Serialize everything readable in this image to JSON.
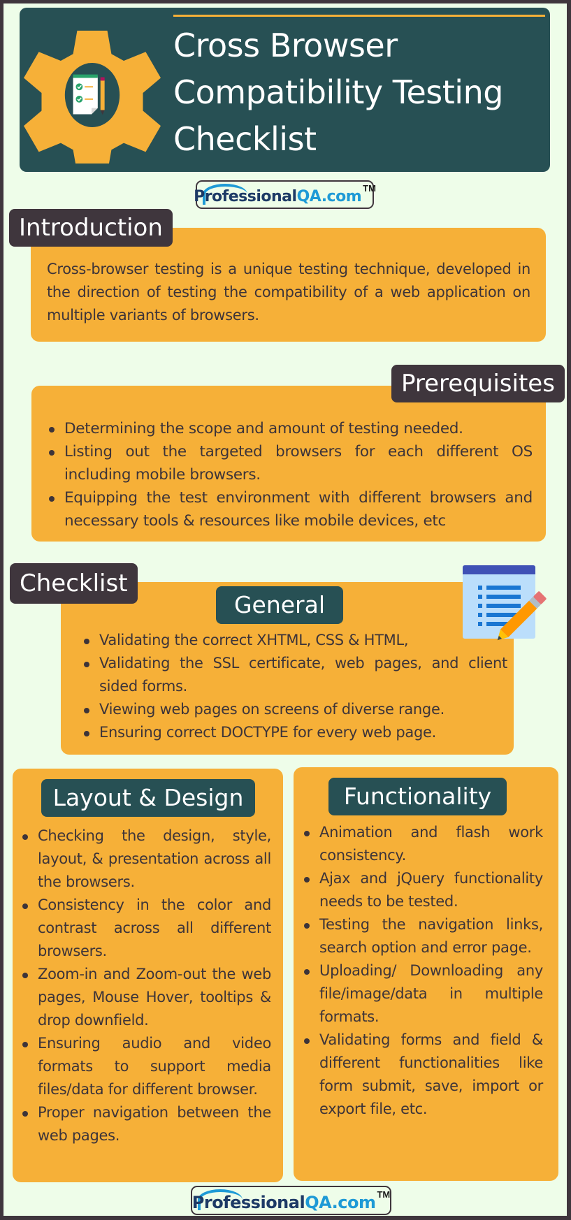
{
  "header": {
    "title_lines": [
      "Cross Browser",
      "Compatibility Testing",
      "Checklist"
    ],
    "icon": "gear-checklist-icon"
  },
  "logo": {
    "name_part1": "Professional",
    "name_part2": "QA",
    "name_part3": ".com",
    "trademark": "TM"
  },
  "introduction": {
    "label": "Introduction",
    "text": "Cross-browser testing is a unique testing technique, developed in the direction of testing the compatibility of a web application on multiple variants of browsers."
  },
  "prerequisites": {
    "label": "Prerequisites",
    "items": [
      "Determining the scope and amount of testing needed.",
      "Listing out the targeted browsers for each different OS including mobile browsers.",
      "Equipping the test environment with different browsers and necessary tools & resources like mobile devices, etc"
    ]
  },
  "checklist": {
    "label": "Checklist",
    "icon": "notepad-pencil-icon",
    "general": {
      "label": "General",
      "items": [
        "Validating the correct XHTML, CSS & HTML,",
        "Validating the SSL certificate, web pages, and client sided forms.",
        "Viewing web pages on screens of diverse range.",
        "Ensuring correct DOCTYPE for every web page."
      ]
    },
    "layout_design": {
      "label": "Layout & Design",
      "items": [
        "Checking the design, style, layout, & presentation across all the browsers.",
        "Consistency in the color and contrast across all different browsers.",
        "Zoom-in and Zoom-out the web pages, Mouse Hover, tooltips & drop downfield.",
        "Ensuring audio and video formats to support media files/data for different browser.",
        "Proper navigation between the web pages."
      ]
    },
    "functionality": {
      "label": "Functionality",
      "items": [
        "Animation and flash work consistency.",
        "Ajax and jQuery functionality needs to be tested.",
        "Testing the navigation links, search option and error page.",
        "Uploading/ Downloading any file/image/data in multiple formats.",
        "Validating forms and field & different functionalities like form submit, save, import or export file, etc."
      ]
    }
  },
  "colors": {
    "background": "#eefde9",
    "header_teal": "#275054",
    "accent_orange": "#f6b038",
    "label_dark": "#3f363d",
    "logo_blue": "#1e9ad6",
    "logo_navy": "#1d3a66",
    "text": "#3d3439"
  }
}
